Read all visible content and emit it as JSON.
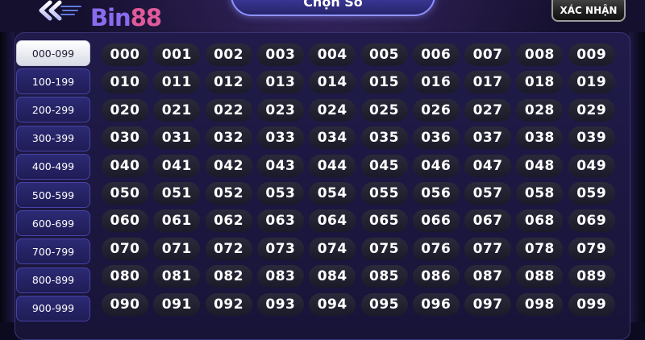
{
  "header": {
    "logo": {
      "part_a": "Bin",
      "part_b": "88"
    },
    "title": "Chọn Số",
    "confirm_label": "XÁC NHẬN",
    "back_icon": "double-chevron-left-icon"
  },
  "colors": {
    "background": "#0c0a1f",
    "panel": "#1d1844",
    "tab_inactive": "#2c2a74",
    "tab_active": "#ffffff",
    "number_chip": "#252435",
    "title_tab": "#4a4bb8",
    "logo_purple": "#8b6bf0",
    "logo_pink": "#e05a9a"
  },
  "ranges": {
    "active_index": 0,
    "items": [
      "000-099",
      "100-199",
      "200-299",
      "300-399",
      "400-499",
      "500-599",
      "600-699",
      "700-799",
      "800-899",
      "900-999"
    ]
  },
  "numbers": [
    [
      "000",
      "001",
      "002",
      "003",
      "004",
      "005",
      "006",
      "007",
      "008",
      "009"
    ],
    [
      "010",
      "011",
      "012",
      "013",
      "014",
      "015",
      "016",
      "017",
      "018",
      "019"
    ],
    [
      "020",
      "021",
      "022",
      "023",
      "024",
      "025",
      "026",
      "027",
      "028",
      "029"
    ],
    [
      "030",
      "031",
      "032",
      "033",
      "034",
      "035",
      "036",
      "037",
      "038",
      "039"
    ],
    [
      "040",
      "041",
      "042",
      "043",
      "044",
      "045",
      "046",
      "047",
      "048",
      "049"
    ],
    [
      "050",
      "051",
      "052",
      "053",
      "054",
      "055",
      "056",
      "057",
      "058",
      "059"
    ],
    [
      "060",
      "061",
      "062",
      "063",
      "064",
      "065",
      "066",
      "067",
      "068",
      "069"
    ],
    [
      "070",
      "071",
      "072",
      "073",
      "074",
      "075",
      "076",
      "077",
      "078",
      "079"
    ],
    [
      "080",
      "081",
      "082",
      "083",
      "084",
      "085",
      "086",
      "087",
      "088",
      "089"
    ],
    [
      "090",
      "091",
      "092",
      "093",
      "094",
      "095",
      "096",
      "097",
      "098",
      "099"
    ]
  ]
}
